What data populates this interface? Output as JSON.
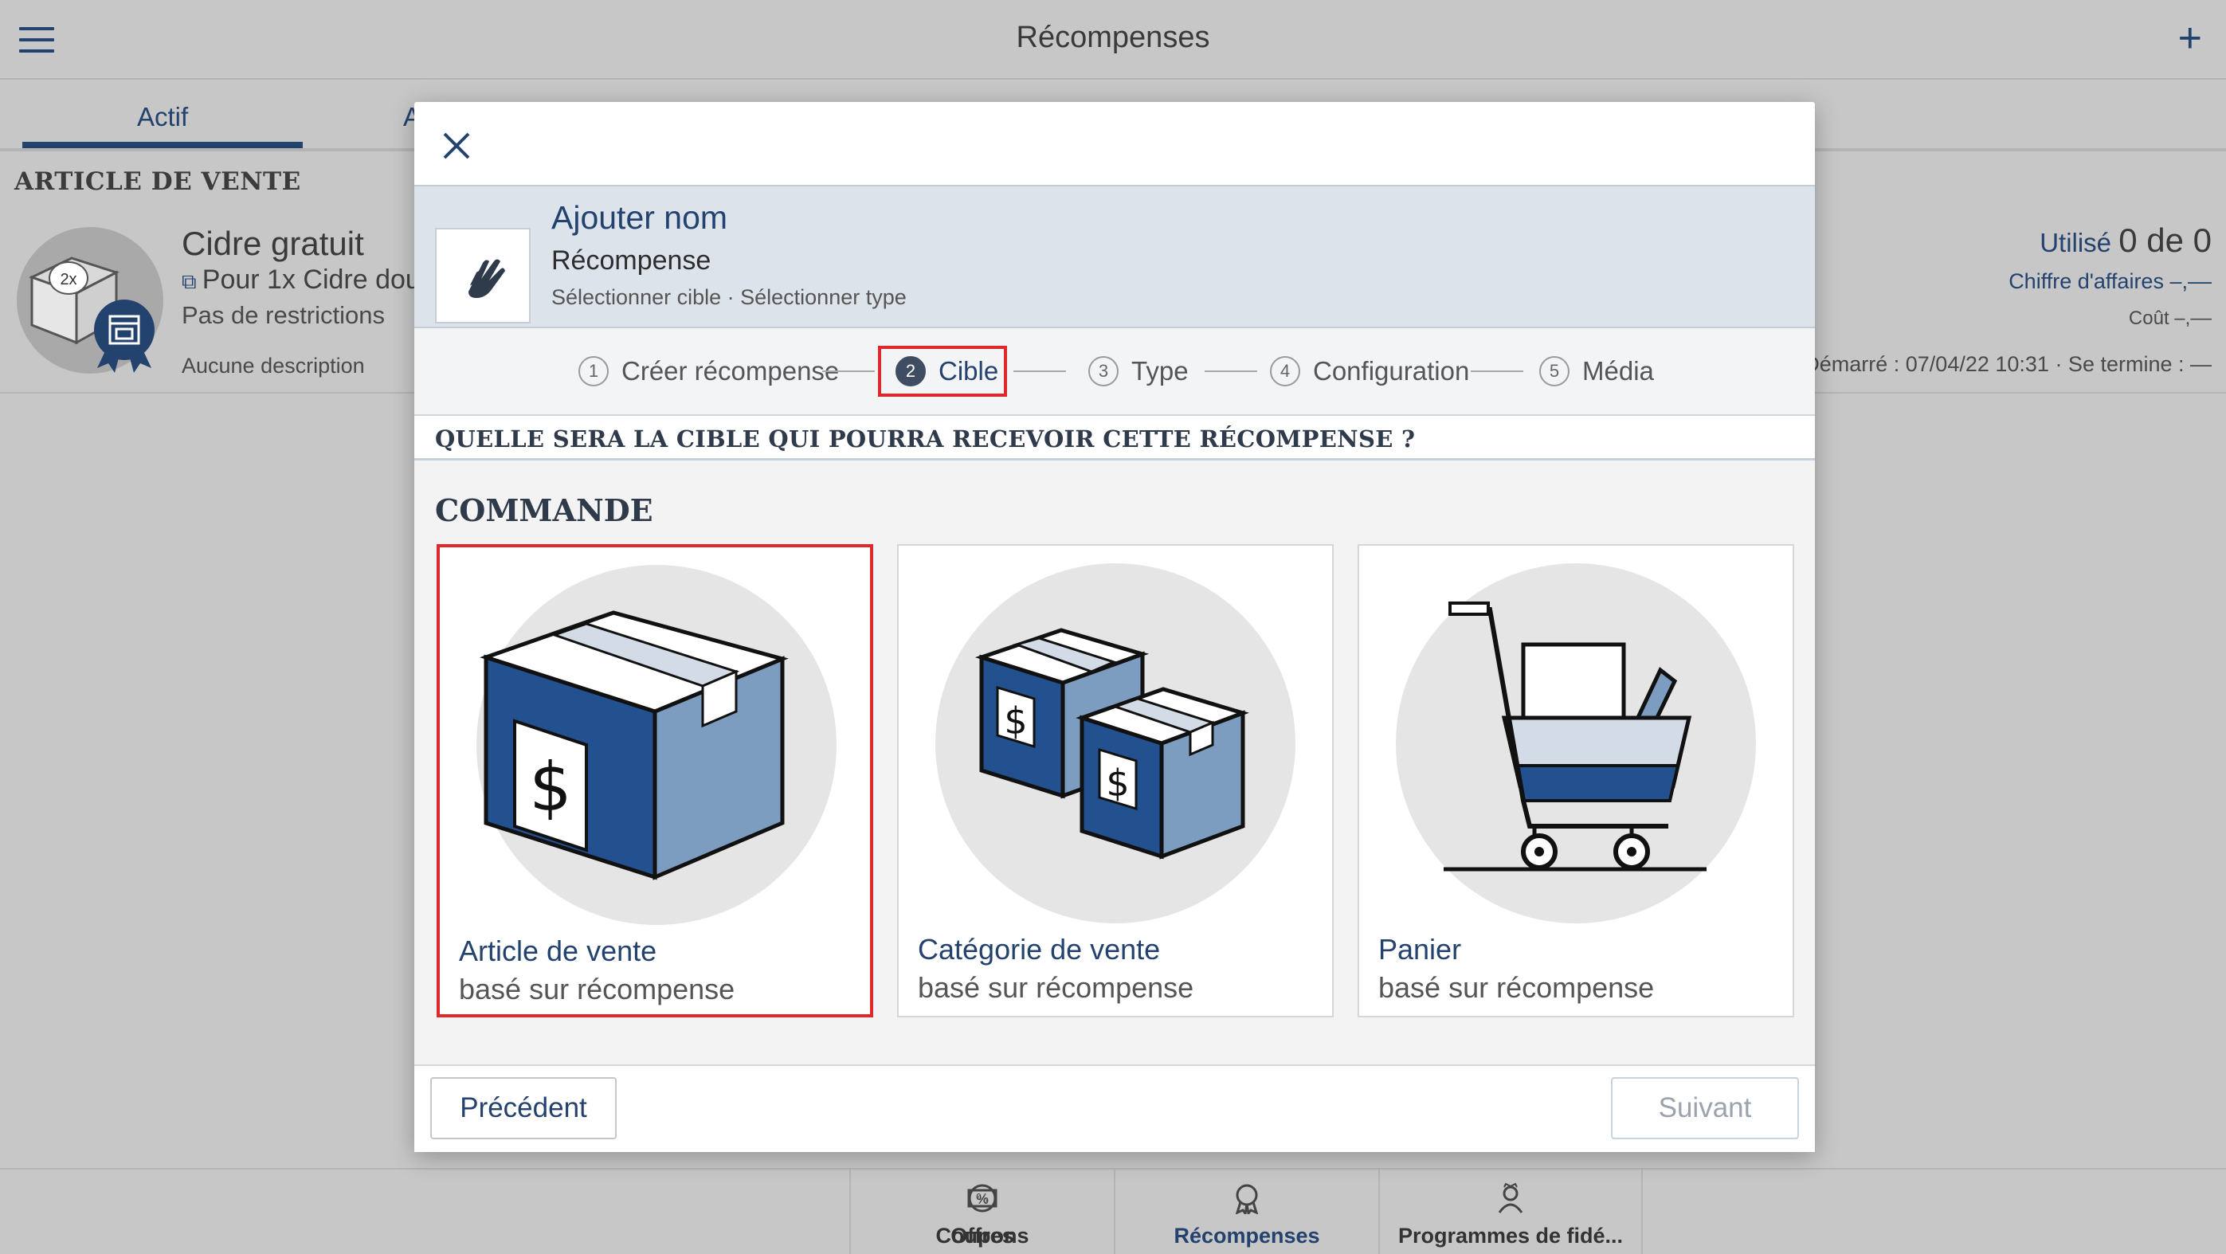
{
  "app": {
    "title": "Récompenses"
  },
  "tabs": [
    {
      "label": "Actif"
    },
    {
      "label": "A"
    }
  ],
  "list": {
    "section": "ARTICLE DE VENTE",
    "item": {
      "badge": "2x",
      "title": "Cidre gratuit",
      "subtitle": "Pour 1x Cidre dou",
      "restrictions": "Pas de restrictions",
      "description": "Aucune description",
      "used_label": "Utilisé",
      "used_value": "0 de 0",
      "revenue": "Chiffre d'affaires –,––",
      "cost": "Coût –,––",
      "dates": "Démarré : 07/04/22 10:31 · Se termine : —"
    }
  },
  "bottom_nav": [
    {
      "label": "Offres",
      "icon": "percent-badge-icon"
    },
    {
      "label": "Coupons",
      "icon": "coupon-icon"
    },
    {
      "label": "Récompenses",
      "icon": "reward-icon"
    },
    {
      "label": "Programmes de fidé...",
      "icon": "loyalty-icon"
    }
  ],
  "modal": {
    "name": "Ajouter nom",
    "type": "Récompense",
    "hint": "Sélectionner cible · Sélectionner type",
    "steps": [
      {
        "num": "1",
        "label": "Créer récompense"
      },
      {
        "num": "2",
        "label": "Cible"
      },
      {
        "num": "3",
        "label": "Type"
      },
      {
        "num": "4",
        "label": "Configuration"
      },
      {
        "num": "5",
        "label": "Média"
      }
    ],
    "question": "QUELLE SERA LA CIBLE QUI POURRA RECEVOIR CETTE RÉCOMPENSE ?",
    "category": "COMMANDE",
    "options": [
      {
        "title": "Article de vente",
        "subtitle": "basé sur récompense",
        "icon": "sales-item-box-icon"
      },
      {
        "title": "Catégorie de vente",
        "subtitle": "basé sur récompense",
        "icon": "sales-category-boxes-icon"
      },
      {
        "title": "Panier",
        "subtitle": "basé sur récompense",
        "icon": "shopping-cart-icon"
      }
    ],
    "prev_label": "Précédent",
    "next_label": "Suivant"
  }
}
